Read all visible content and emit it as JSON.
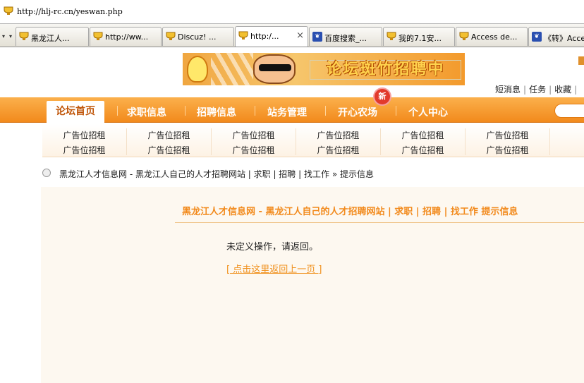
{
  "browser": {
    "url": "http://hlj-rc.cn/yeswan.php",
    "tabs": [
      {
        "label": "黑龙江人...",
        "icon": "trophy-icon"
      },
      {
        "label": "http://ww...",
        "icon": "trophy-icon"
      },
      {
        "label": "Discuz! ...",
        "icon": "trophy-icon"
      },
      {
        "label": "http:/...",
        "icon": "trophy-icon",
        "active": true,
        "close": "×"
      },
      {
        "label": "百度搜索_...",
        "icon": "paw-icon"
      },
      {
        "label": "我的7.1安...",
        "icon": "trophy-icon"
      },
      {
        "label": "Access de...",
        "icon": "trophy-icon"
      },
      {
        "label": "《转》Acces",
        "icon": "paw-icon"
      }
    ]
  },
  "banner": {
    "text": "论坛斑竹招聘中"
  },
  "top_links": [
    "短消息",
    "任务",
    "收藏"
  ],
  "nav": {
    "home": "论坛首页",
    "items": [
      "求职信息",
      "招聘信息",
      "站务管理",
      "开心农场",
      "个人中心"
    ],
    "new_badge": "新"
  },
  "subnav": {
    "columns": [
      [
        "广告位招租",
        "广告位招租"
      ],
      [
        "广告位招租",
        "广告位招租"
      ],
      [
        "广告位招租",
        "广告位招租"
      ],
      [
        "广告位招租",
        "广告位招租"
      ],
      [
        "广告位招租",
        "广告位招租"
      ],
      [
        "广告位招租",
        "广告位招租"
      ]
    ]
  },
  "breadcrumb": {
    "site": "黑龙江人才信息网 - 黑龙江人自己的人才招聘网站 | 求职 | 招聘 | 找工作",
    "separator": "»",
    "current": "提示信息"
  },
  "panel": {
    "title": "黑龙江人才信息网 - 黑龙江人自己的人才招聘网站 | 求职 | 招聘 | 找工作 提示信息",
    "message": "未定义操作，请返回。",
    "back_link": "[ 点击这里返回上一页 ]"
  },
  "colors": {
    "accent": "#f28a1c",
    "nav_top": "#fbb04c",
    "panel_bg": "#fdf8f0"
  }
}
